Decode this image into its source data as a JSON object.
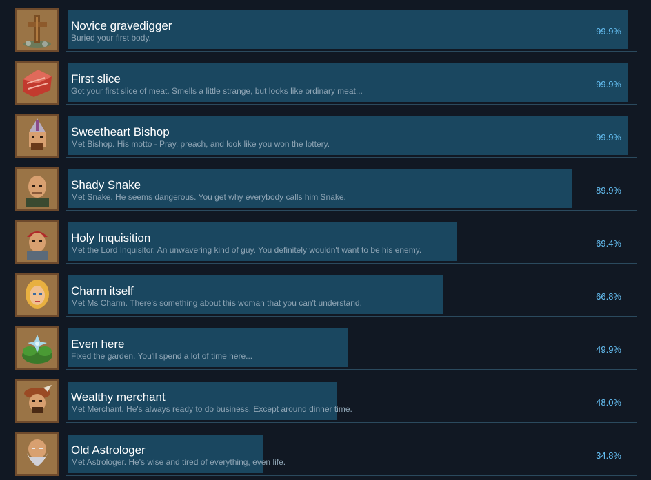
{
  "achievements": [
    {
      "title": "Novice gravedigger",
      "description": "Buried your first body.",
      "percent_label": "99.9%",
      "percent": 99.9,
      "icon": "grave-cross-icon"
    },
    {
      "title": "First slice",
      "description": "Got your first slice of meat. Smells a little strange, but looks like ordinary meat...",
      "percent_label": "99.9%",
      "percent": 99.9,
      "icon": "meat-slice-icon"
    },
    {
      "title": "Sweetheart Bishop",
      "description": "Met Bishop. His motto - Pray, preach, and look like you won the lottery.",
      "percent_label": "99.9%",
      "percent": 99.9,
      "icon": "bishop-portrait-icon"
    },
    {
      "title": "Shady Snake",
      "description": "Met Snake. He seems dangerous. You get why everybody calls him Snake.",
      "percent_label": "89.9%",
      "percent": 89.9,
      "icon": "snake-portrait-icon"
    },
    {
      "title": "Holy Inquisition",
      "description": "Met the Lord Inquisitor. An unwavering kind of guy. You definitely wouldn't want to be his enemy.",
      "percent_label": "69.4%",
      "percent": 69.4,
      "icon": "inquisitor-portrait-icon"
    },
    {
      "title": "Charm itself",
      "description": "Met Ms Charm. There's something about this woman that you can't understand.",
      "percent_label": "66.8%",
      "percent": 66.8,
      "icon": "charm-portrait-icon"
    },
    {
      "title": "Even here",
      "description": "Fixed the garden. You'll spend a lot of time here...",
      "percent_label": "49.9%",
      "percent": 49.9,
      "icon": "garden-flower-icon"
    },
    {
      "title": "Wealthy merchant",
      "description": "Met Merchant. He's always ready to do business. Except around dinner time.",
      "percent_label": "48.0%",
      "percent": 48.0,
      "icon": "merchant-portrait-icon"
    },
    {
      "title": "Old Astrologer",
      "description": "Met Astrologer. He's wise and tired of everything, even life.",
      "percent_label": "34.8%",
      "percent": 34.8,
      "icon": "astrologer-portrait-icon"
    }
  ]
}
